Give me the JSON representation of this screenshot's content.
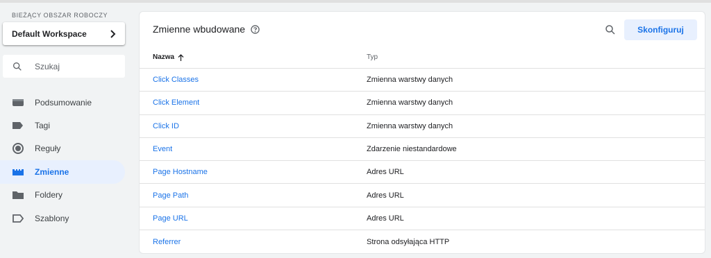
{
  "workspace": {
    "caption": "BIEŻĄCY OBSZAR ROBOCZY",
    "name": "Default Workspace"
  },
  "search": {
    "placeholder": "Szukaj"
  },
  "nav": {
    "items": [
      {
        "label": "Podsumowanie",
        "icon": "overview-icon"
      },
      {
        "label": "Tagi",
        "icon": "tag-icon"
      },
      {
        "label": "Reguły",
        "icon": "trigger-icon"
      },
      {
        "label": "Zmienne",
        "icon": "variables-icon",
        "active": true
      },
      {
        "label": "Foldery",
        "icon": "folder-icon"
      },
      {
        "label": "Szablony",
        "icon": "template-icon"
      }
    ]
  },
  "main": {
    "title": "Zmienne wbudowane",
    "configure_label": "Skonfiguruj",
    "columns": {
      "name": "Nazwa",
      "type": "Typ"
    },
    "rows": [
      {
        "name": "Click Classes",
        "type": "Zmienna warstwy danych"
      },
      {
        "name": "Click Element",
        "type": "Zmienna warstwy danych"
      },
      {
        "name": "Click ID",
        "type": "Zmienna warstwy danych"
      },
      {
        "name": "Event",
        "type": "Zdarzenie niestandardowe"
      },
      {
        "name": "Page Hostname",
        "type": "Adres URL"
      },
      {
        "name": "Page Path",
        "type": "Adres URL"
      },
      {
        "name": "Page URL",
        "type": "Adres URL"
      },
      {
        "name": "Referrer",
        "type": "Strona odsyłająca HTTP"
      }
    ]
  },
  "colors": {
    "accent": "#1a73e8",
    "active_bg": "#e8f0fe",
    "page_bg": "#f1f3f4"
  }
}
